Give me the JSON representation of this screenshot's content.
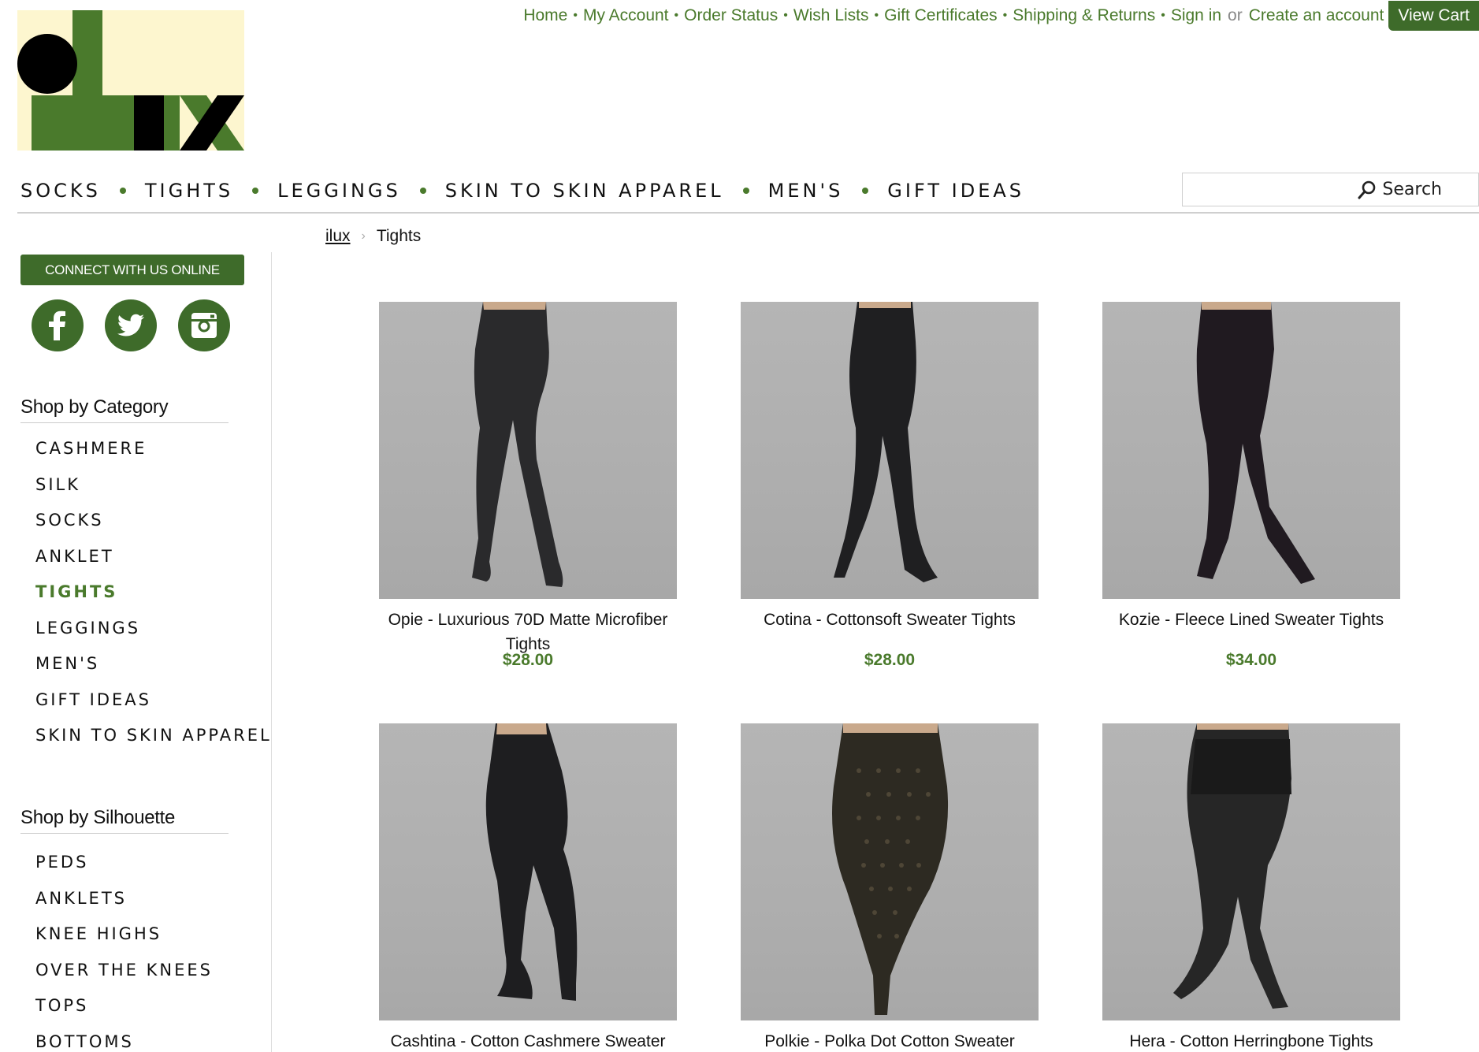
{
  "logo": {
    "alt": "ilux"
  },
  "top_links": {
    "home": "Home",
    "my_account": "My Account",
    "order_status": "Order Status",
    "wish_lists": "Wish Lists",
    "gift_certificates": "Gift Certificates",
    "shipping_returns": "Shipping & Returns",
    "sign_in": "Sign in",
    "or": "or",
    "create_account": "Create an account",
    "view_cart": "View Cart",
    "separator": "•"
  },
  "main_nav": {
    "items": [
      "SOCKS",
      "TIGHTS",
      "LEGGINGS",
      "SKIN TO SKIN APPAREL",
      "MEN'S",
      "GIFT IDEAS"
    ]
  },
  "search": {
    "label": "Search",
    "placeholder": ""
  },
  "breadcrumb": {
    "home": "ilux",
    "separator": "›",
    "current": "Tights"
  },
  "sidebar": {
    "connect_label": "CONNECT WITH US ONLINE",
    "social": [
      "facebook-icon",
      "twitter-icon",
      "instagram-icon"
    ],
    "category_heading": "Shop by Category",
    "categories": [
      "CASHMERE",
      "SILK",
      "SOCKS",
      "ANKLET",
      "TIGHTS",
      "LEGGINGS",
      "MEN'S",
      "GIFT IDEAS",
      "SKIN TO SKIN APPAREL"
    ],
    "active_category": "TIGHTS",
    "silhouette_heading": "Shop by Silhouette",
    "silhouettes": [
      "PEDS",
      "ANKLETS",
      "KNEE HIGHS",
      "OVER THE KNEES",
      "TOPS",
      "BOTTOMS"
    ]
  },
  "products": [
    {
      "name": "Opie - Luxurious 70D Matte Microfiber Tights",
      "price": "$28.00"
    },
    {
      "name": "Cotina - Cottonsoft Sweater Tights",
      "price": "$28.00"
    },
    {
      "name": "Kozie - Fleece Lined Sweater Tights",
      "price": "$34.00"
    },
    {
      "name": "Cashtina - Cotton Cashmere Sweater",
      "price": ""
    },
    {
      "name": "Polkie - Polka Dot Cotton Sweater Tights",
      "price": ""
    },
    {
      "name": "Hera - Cotton Herringbone Tights",
      "price": ""
    }
  ],
  "colors": {
    "brand_green": "#4a7a2c",
    "button_green": "#3e6b2a",
    "logo_bg": "#fdf6cf"
  }
}
